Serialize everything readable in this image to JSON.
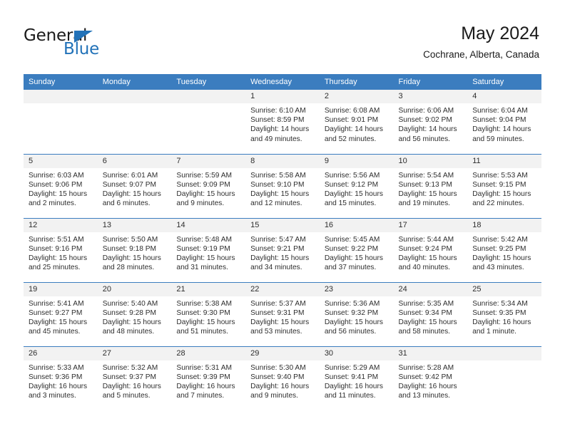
{
  "brand": {
    "name_top": "General",
    "name_bottom": "Blue",
    "accent_color": "#2272b8"
  },
  "header": {
    "title": "May 2024",
    "subtitle": "Cochrane, Alberta, Canada"
  },
  "theme": {
    "header_row_bg": "#3b7dbf",
    "daynum_bg": "#f2f2f2",
    "text_color": "#2e2e2e",
    "page_bg": "#ffffff"
  },
  "weekdays": [
    "Sunday",
    "Monday",
    "Tuesday",
    "Wednesday",
    "Thursday",
    "Friday",
    "Saturday"
  ],
  "labels": {
    "sunrise_prefix": "Sunrise:",
    "sunset_prefix": "Sunset:",
    "daylight_prefix": "Daylight:"
  },
  "weeks": [
    [
      {
        "day": "",
        "sunrise": "",
        "sunset": "",
        "daylight": "",
        "empty": true
      },
      {
        "day": "",
        "sunrise": "",
        "sunset": "",
        "daylight": "",
        "empty": true
      },
      {
        "day": "",
        "sunrise": "",
        "sunset": "",
        "daylight": "",
        "empty": true
      },
      {
        "day": "1",
        "sunrise": "Sunrise: 6:10 AM",
        "sunset": "Sunset: 8:59 PM",
        "daylight": "Daylight: 14 hours and 49 minutes."
      },
      {
        "day": "2",
        "sunrise": "Sunrise: 6:08 AM",
        "sunset": "Sunset: 9:01 PM",
        "daylight": "Daylight: 14 hours and 52 minutes."
      },
      {
        "day": "3",
        "sunrise": "Sunrise: 6:06 AM",
        "sunset": "Sunset: 9:02 PM",
        "daylight": "Daylight: 14 hours and 56 minutes."
      },
      {
        "day": "4",
        "sunrise": "Sunrise: 6:04 AM",
        "sunset": "Sunset: 9:04 PM",
        "daylight": "Daylight: 14 hours and 59 minutes."
      }
    ],
    [
      {
        "day": "5",
        "sunrise": "Sunrise: 6:03 AM",
        "sunset": "Sunset: 9:06 PM",
        "daylight": "Daylight: 15 hours and 2 minutes."
      },
      {
        "day": "6",
        "sunrise": "Sunrise: 6:01 AM",
        "sunset": "Sunset: 9:07 PM",
        "daylight": "Daylight: 15 hours and 6 minutes."
      },
      {
        "day": "7",
        "sunrise": "Sunrise: 5:59 AM",
        "sunset": "Sunset: 9:09 PM",
        "daylight": "Daylight: 15 hours and 9 minutes."
      },
      {
        "day": "8",
        "sunrise": "Sunrise: 5:58 AM",
        "sunset": "Sunset: 9:10 PM",
        "daylight": "Daylight: 15 hours and 12 minutes."
      },
      {
        "day": "9",
        "sunrise": "Sunrise: 5:56 AM",
        "sunset": "Sunset: 9:12 PM",
        "daylight": "Daylight: 15 hours and 15 minutes."
      },
      {
        "day": "10",
        "sunrise": "Sunrise: 5:54 AM",
        "sunset": "Sunset: 9:13 PM",
        "daylight": "Daylight: 15 hours and 19 minutes."
      },
      {
        "day": "11",
        "sunrise": "Sunrise: 5:53 AM",
        "sunset": "Sunset: 9:15 PM",
        "daylight": "Daylight: 15 hours and 22 minutes."
      }
    ],
    [
      {
        "day": "12",
        "sunrise": "Sunrise: 5:51 AM",
        "sunset": "Sunset: 9:16 PM",
        "daylight": "Daylight: 15 hours and 25 minutes."
      },
      {
        "day": "13",
        "sunrise": "Sunrise: 5:50 AM",
        "sunset": "Sunset: 9:18 PM",
        "daylight": "Daylight: 15 hours and 28 minutes."
      },
      {
        "day": "14",
        "sunrise": "Sunrise: 5:48 AM",
        "sunset": "Sunset: 9:19 PM",
        "daylight": "Daylight: 15 hours and 31 minutes."
      },
      {
        "day": "15",
        "sunrise": "Sunrise: 5:47 AM",
        "sunset": "Sunset: 9:21 PM",
        "daylight": "Daylight: 15 hours and 34 minutes."
      },
      {
        "day": "16",
        "sunrise": "Sunrise: 5:45 AM",
        "sunset": "Sunset: 9:22 PM",
        "daylight": "Daylight: 15 hours and 37 minutes."
      },
      {
        "day": "17",
        "sunrise": "Sunrise: 5:44 AM",
        "sunset": "Sunset: 9:24 PM",
        "daylight": "Daylight: 15 hours and 40 minutes."
      },
      {
        "day": "18",
        "sunrise": "Sunrise: 5:42 AM",
        "sunset": "Sunset: 9:25 PM",
        "daylight": "Daylight: 15 hours and 43 minutes."
      }
    ],
    [
      {
        "day": "19",
        "sunrise": "Sunrise: 5:41 AM",
        "sunset": "Sunset: 9:27 PM",
        "daylight": "Daylight: 15 hours and 45 minutes."
      },
      {
        "day": "20",
        "sunrise": "Sunrise: 5:40 AM",
        "sunset": "Sunset: 9:28 PM",
        "daylight": "Daylight: 15 hours and 48 minutes."
      },
      {
        "day": "21",
        "sunrise": "Sunrise: 5:38 AM",
        "sunset": "Sunset: 9:30 PM",
        "daylight": "Daylight: 15 hours and 51 minutes."
      },
      {
        "day": "22",
        "sunrise": "Sunrise: 5:37 AM",
        "sunset": "Sunset: 9:31 PM",
        "daylight": "Daylight: 15 hours and 53 minutes."
      },
      {
        "day": "23",
        "sunrise": "Sunrise: 5:36 AM",
        "sunset": "Sunset: 9:32 PM",
        "daylight": "Daylight: 15 hours and 56 minutes."
      },
      {
        "day": "24",
        "sunrise": "Sunrise: 5:35 AM",
        "sunset": "Sunset: 9:34 PM",
        "daylight": "Daylight: 15 hours and 58 minutes."
      },
      {
        "day": "25",
        "sunrise": "Sunrise: 5:34 AM",
        "sunset": "Sunset: 9:35 PM",
        "daylight": "Daylight: 16 hours and 1 minute."
      }
    ],
    [
      {
        "day": "26",
        "sunrise": "Sunrise: 5:33 AM",
        "sunset": "Sunset: 9:36 PM",
        "daylight": "Daylight: 16 hours and 3 minutes."
      },
      {
        "day": "27",
        "sunrise": "Sunrise: 5:32 AM",
        "sunset": "Sunset: 9:37 PM",
        "daylight": "Daylight: 16 hours and 5 minutes."
      },
      {
        "day": "28",
        "sunrise": "Sunrise: 5:31 AM",
        "sunset": "Sunset: 9:39 PM",
        "daylight": "Daylight: 16 hours and 7 minutes."
      },
      {
        "day": "29",
        "sunrise": "Sunrise: 5:30 AM",
        "sunset": "Sunset: 9:40 PM",
        "daylight": "Daylight: 16 hours and 9 minutes."
      },
      {
        "day": "30",
        "sunrise": "Sunrise: 5:29 AM",
        "sunset": "Sunset: 9:41 PM",
        "daylight": "Daylight: 16 hours and 11 minutes."
      },
      {
        "day": "31",
        "sunrise": "Sunrise: 5:28 AM",
        "sunset": "Sunset: 9:42 PM",
        "daylight": "Daylight: 16 hours and 13 minutes."
      },
      {
        "day": "",
        "sunrise": "",
        "sunset": "",
        "daylight": "",
        "empty": true
      }
    ]
  ]
}
